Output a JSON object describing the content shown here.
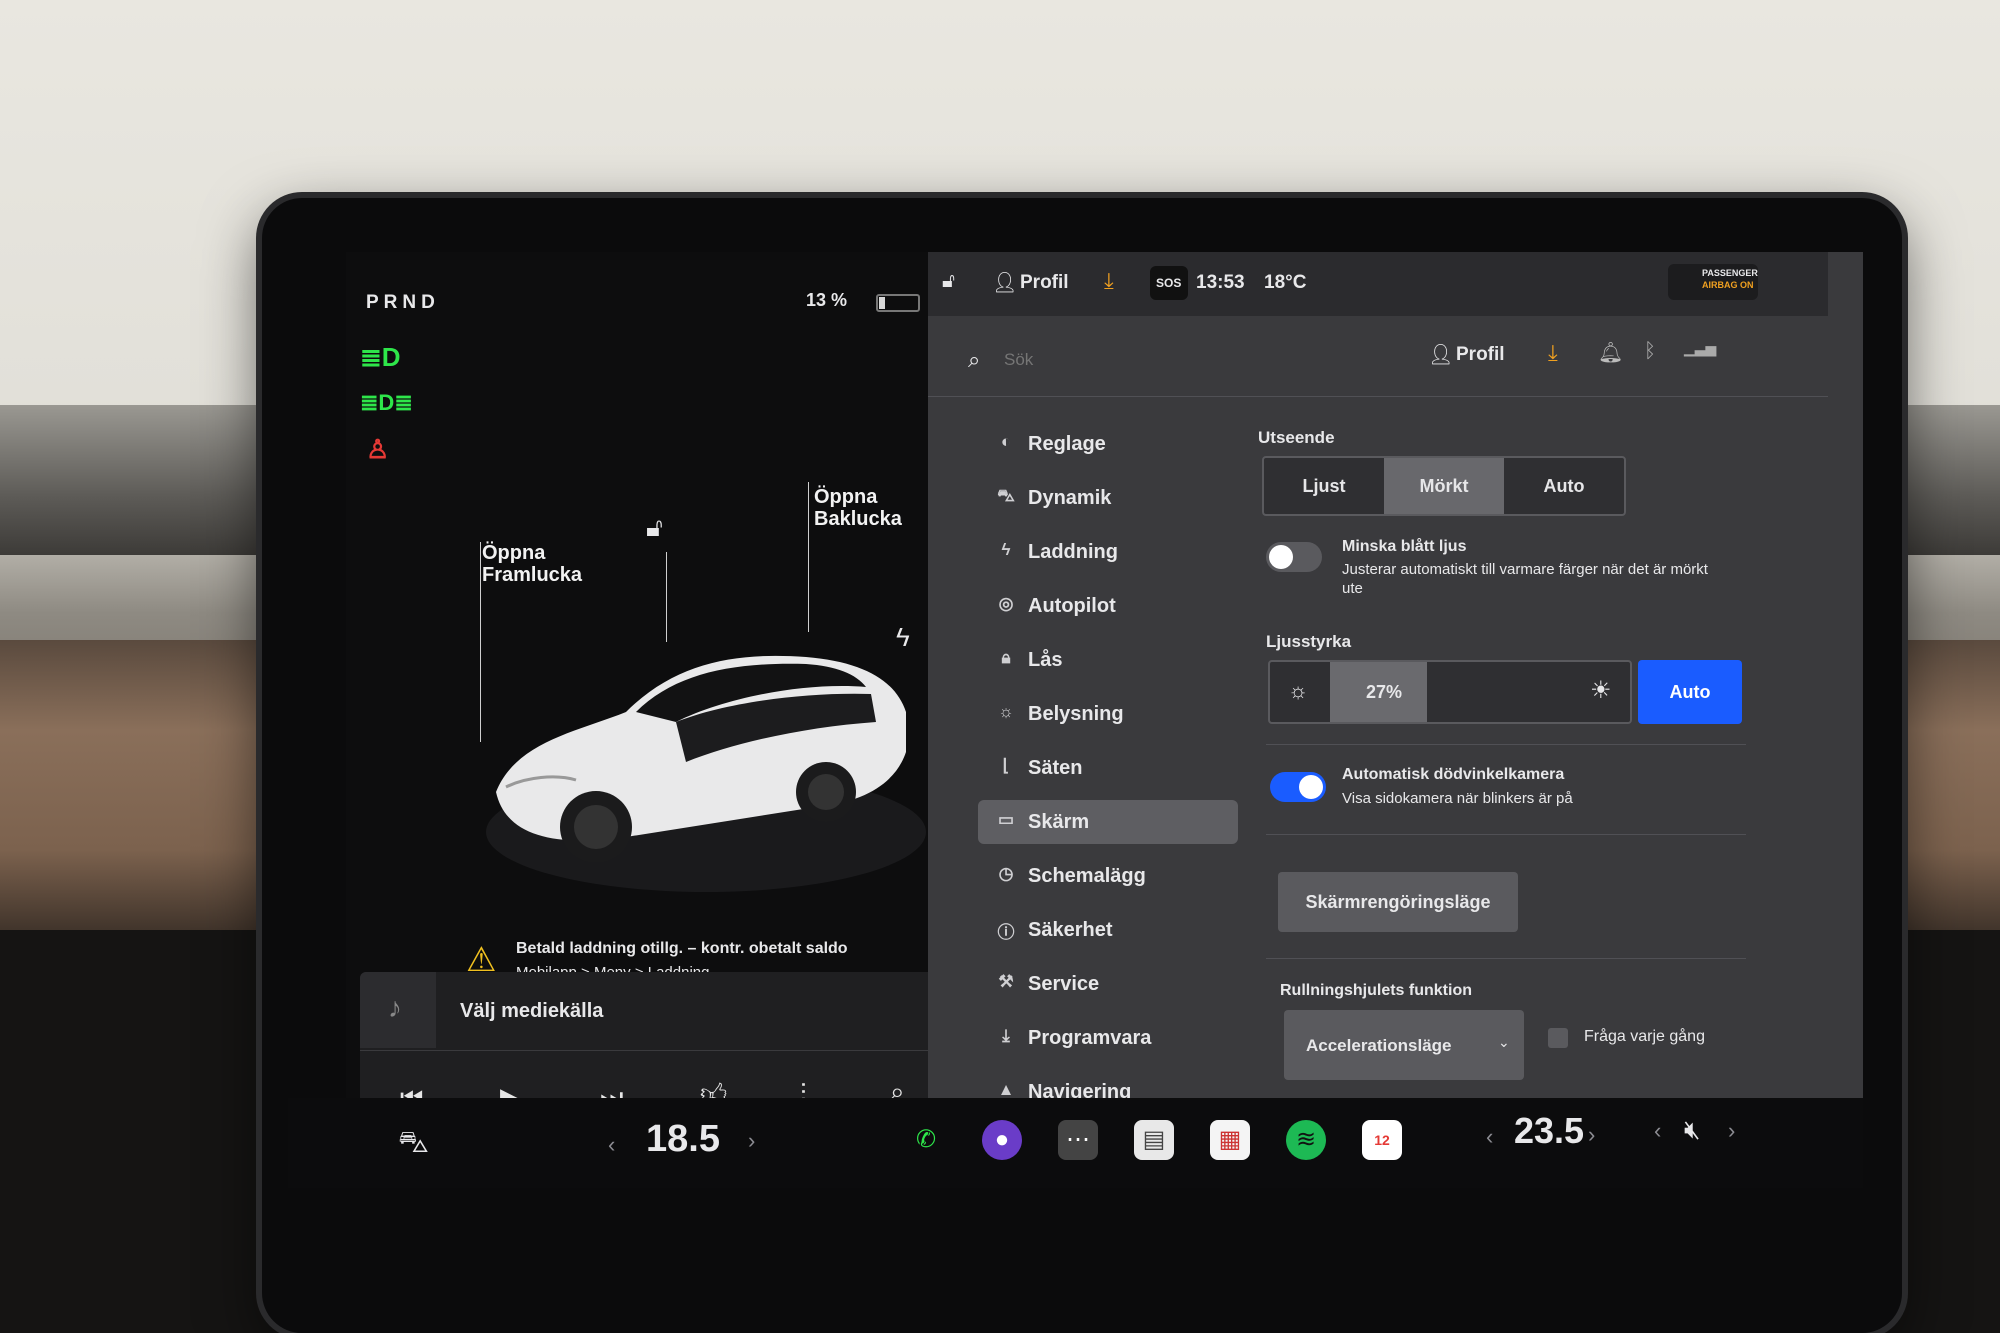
{
  "status": {
    "gear": "PRND",
    "battery_percent": "13 %",
    "time": "13:53",
    "temperature": "18°C",
    "profile": "Profil",
    "sos": "SOS",
    "airbag_line1": "PASSENGER",
    "airbag_line2": "AIRBAG ON"
  },
  "car_view": {
    "open_frunk": "Öppna\nFramlucka",
    "open_trunk": "Öppna\nBaklucka",
    "warning_line1": "Betald laddning otillg. – kontr. obetalt saldo",
    "warning_line2": "Mobilapp > Meny > Laddning"
  },
  "media": {
    "source_label": "Välj mediekälla"
  },
  "search": {
    "placeholder": "Sök",
    "profile": "Profil"
  },
  "menu": {
    "items": [
      {
        "label": "Reglage",
        "icon": "toggle-icon"
      },
      {
        "label": "Dynamik",
        "icon": "car-icon"
      },
      {
        "label": "Laddning",
        "icon": "bolt-icon"
      },
      {
        "label": "Autopilot",
        "icon": "steering-icon"
      },
      {
        "label": "Lås",
        "icon": "lock-icon"
      },
      {
        "label": "Belysning",
        "icon": "sun-icon"
      },
      {
        "label": "Säten",
        "icon": "seat-icon"
      },
      {
        "label": "Skärm",
        "icon": "display-icon"
      },
      {
        "label": "Schemalägg",
        "icon": "clock-icon"
      },
      {
        "label": "Säkerhet",
        "icon": "info-icon"
      },
      {
        "label": "Service",
        "icon": "wrench-icon"
      },
      {
        "label": "Programvara",
        "icon": "download-icon"
      },
      {
        "label": "Navigering",
        "icon": "navigation-icon"
      }
    ],
    "active_index": 7
  },
  "display_settings": {
    "appearance_title": "Utseende",
    "appearance_options": [
      "Ljust",
      "Mörkt",
      "Auto"
    ],
    "appearance_selected": 1,
    "blue_light_title": "Minska blått ljus",
    "blue_light_desc": "Justerar automatiskt till varmare färger när det är mörkt ute",
    "blue_light_on": false,
    "brightness_title": "Ljusstyrka",
    "brightness_value": "27%",
    "brightness_level": 0.27,
    "brightness_auto": "Auto",
    "blindspot_title": "Automatisk dödvinkelkamera",
    "blindspot_desc": "Visa sidokamera när blinkers är på",
    "blindspot_on": true,
    "clean_mode_button": "Skärmrengöringsläge",
    "scroll_title": "Rullningshjulets funktion",
    "scroll_value": "Accelerationsläge",
    "ask_each_time": "Fråga varje gång"
  },
  "dock": {
    "driver_temp": "18.5",
    "passenger_temp": "23.5",
    "calendar_day": "12"
  },
  "colors": {
    "accent_blue": "#1a5cff",
    "green": "#2ee64a",
    "red": "#e53935",
    "orange": "#f0a020"
  }
}
